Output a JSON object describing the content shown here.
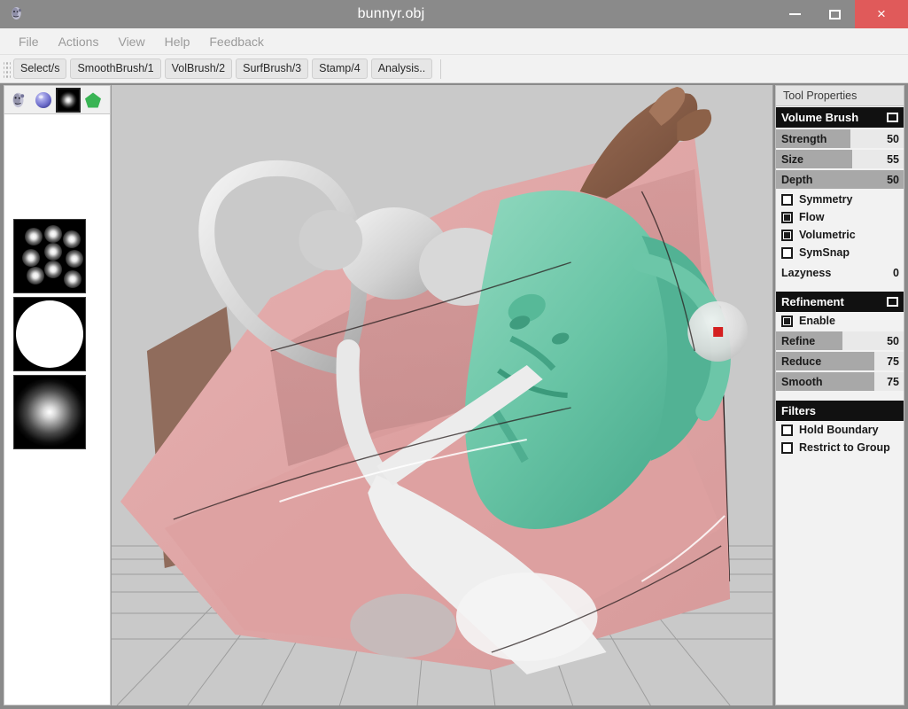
{
  "window": {
    "title": "bunnyr.obj",
    "app_icon": "head-bust-icon",
    "controls": {
      "minimize": "minimize-icon",
      "maximize": "maximize-icon",
      "close": "×"
    }
  },
  "menubar": {
    "items": [
      {
        "label": "File"
      },
      {
        "label": "Actions"
      },
      {
        "label": "View"
      },
      {
        "label": "Help"
      },
      {
        "label": "Feedback"
      }
    ]
  },
  "toolbar": {
    "buttons": [
      {
        "label": "Select/s"
      },
      {
        "label": "SmoothBrush/1"
      },
      {
        "label": "VolBrush/2"
      },
      {
        "label": "SurfBrush/3"
      },
      {
        "label": "Stamp/4"
      },
      {
        "label": "Analysis.."
      }
    ]
  },
  "left_panel": {
    "icon_tabs": [
      {
        "name": "model-head-icon",
        "selected": false
      },
      {
        "name": "sphere-material-icon",
        "selected": false
      },
      {
        "name": "brush-alpha-icon",
        "selected": true
      },
      {
        "name": "green-pentagon-shape-icon",
        "selected": false
      }
    ],
    "brush_thumbnails": [
      {
        "name": "multi-dot-alpha-thumbnail"
      },
      {
        "name": "hard-circle-alpha-thumbnail"
      },
      {
        "name": "soft-radial-alpha-thumbnail"
      }
    ]
  },
  "viewport": {
    "name": "3d-model-viewport",
    "background_color": "#c9c9c9",
    "grid_color": "#8d8d8d",
    "model_colors": {
      "pink": "#e0a7a7",
      "pink_dark": "#c08a8a",
      "white": "#f2f2f2",
      "grey": "#b8b8b8",
      "teal": "#6ec5a8",
      "teal_dark": "#4fae91",
      "brown": "#8a5f4a",
      "shadow": "#4a3333"
    },
    "cursor_marker_color": "#d42020",
    "cursor_sphere_color": "#e2e2e2"
  },
  "right_panel": {
    "header": "Tool Properties",
    "sections": [
      {
        "title": "Volume Brush",
        "collapsible": true,
        "sliders": [
          {
            "label": "Strength",
            "value": 50,
            "fill_pct": 58
          },
          {
            "label": "Size",
            "value": 55,
            "fill_pct": 60
          },
          {
            "label": "Depth",
            "value": 50,
            "fill_pct": 100
          }
        ],
        "checkboxes": [
          {
            "label": "Symmetry",
            "checked": false
          },
          {
            "label": "Flow",
            "checked": true
          },
          {
            "label": "Volumetric",
            "checked": true
          },
          {
            "label": "SymSnap",
            "checked": false
          }
        ],
        "plain_values": [
          {
            "label": "Lazyness",
            "value": 0
          }
        ]
      },
      {
        "title": "Refinement",
        "collapsible": true,
        "checkboxes": [
          {
            "label": "Enable",
            "checked": true
          }
        ],
        "sliders": [
          {
            "label": "Refine",
            "value": 50,
            "fill_pct": 52
          },
          {
            "label": "Reduce",
            "value": 75,
            "fill_pct": 77
          },
          {
            "label": "Smooth",
            "value": 75,
            "fill_pct": 77
          }
        ]
      },
      {
        "title": "Filters",
        "collapsible": false,
        "checkboxes": [
          {
            "label": "Hold Boundary",
            "checked": false
          },
          {
            "label": "Restrict to Group",
            "checked": false
          }
        ]
      }
    ]
  }
}
